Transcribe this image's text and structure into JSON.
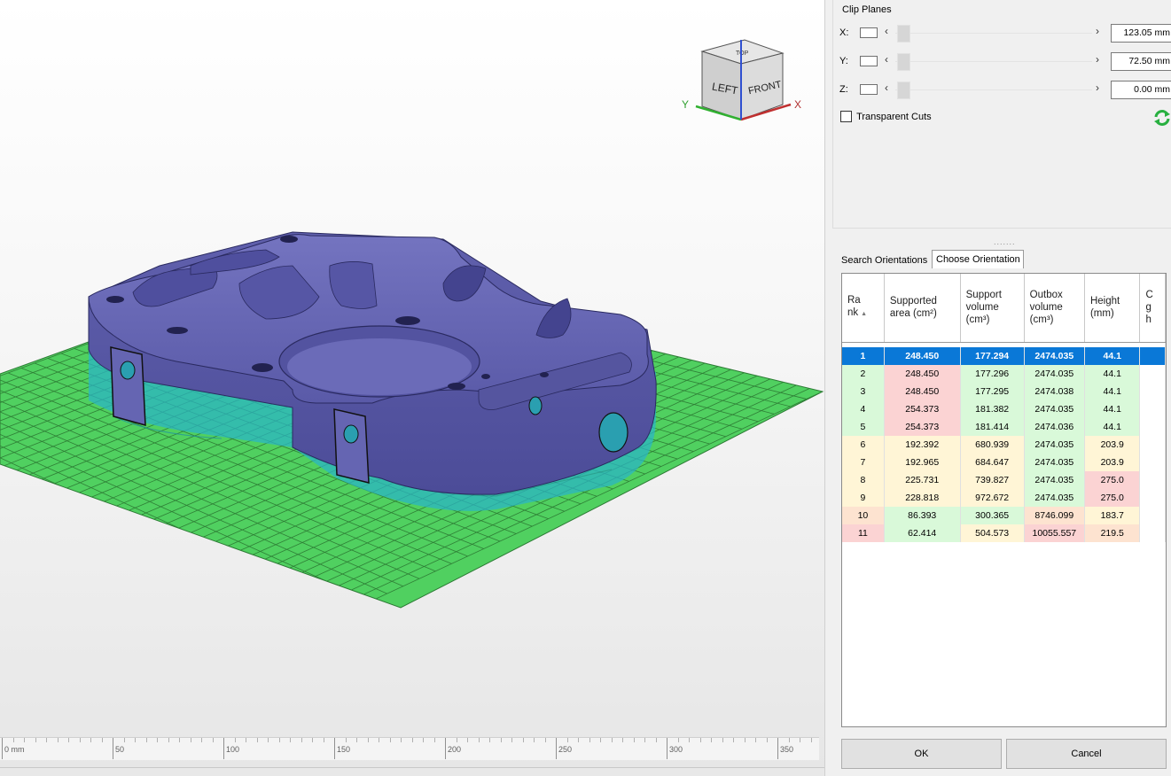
{
  "clip_planes": {
    "title": "Clip Planes",
    "rows": [
      {
        "axis": "X:",
        "value": "123.05 mm"
      },
      {
        "axis": "Y:",
        "value": "72.50 mm"
      },
      {
        "axis": "Z:",
        "value": "0.00 mm"
      }
    ],
    "transparent_cuts_label": "Transparent Cuts",
    "transparent_cuts_checked": false
  },
  "view_cube": {
    "faces": {
      "left": "LEFT",
      "front": "FRONT",
      "top": "TOP"
    },
    "axis_y": "Y",
    "axis_x": "X"
  },
  "ruler": {
    "labels": [
      "0 mm",
      "50",
      "100",
      "150",
      "200",
      "250",
      "300",
      "350"
    ]
  },
  "tabs": [
    {
      "label": "Search Orientations",
      "active": false
    },
    {
      "label": "Choose Orientation",
      "active": true
    }
  ],
  "table": {
    "columns": [
      {
        "line1": "Ra",
        "line2": "nk",
        "line3": ""
      },
      {
        "line1": "Supported",
        "line2": "area (cm²)",
        "line3": ""
      },
      {
        "line1": "Support",
        "line2": "volume",
        "line3": "(cm³)"
      },
      {
        "line1": "Outbox",
        "line2": "volume",
        "line3": "(cm³)"
      },
      {
        "line1": "Height",
        "line2": "(mm)",
        "line3": ""
      },
      {
        "line1": "C",
        "line2": "g",
        "line3": "h"
      }
    ],
    "rows": [
      {
        "rank": "1",
        "area": "248.450",
        "support": "177.294",
        "outbox": "2474.035",
        "height": "44.1",
        "selected": true
      },
      {
        "rank": "2",
        "area": "248.450",
        "support": "177.296",
        "outbox": "2474.035",
        "height": "44.1"
      },
      {
        "rank": "3",
        "area": "248.450",
        "support": "177.295",
        "outbox": "2474.038",
        "height": "44.1"
      },
      {
        "rank": "4",
        "area": "254.373",
        "support": "181.382",
        "outbox": "2474.035",
        "height": "44.1"
      },
      {
        "rank": "5",
        "area": "254.373",
        "support": "181.414",
        "outbox": "2474.036",
        "height": "44.1"
      },
      {
        "rank": "6",
        "area": "192.392",
        "support": "680.939",
        "outbox": "2474.035",
        "height": "203.9"
      },
      {
        "rank": "7",
        "area": "192.965",
        "support": "684.647",
        "outbox": "2474.035",
        "height": "203.9"
      },
      {
        "rank": "8",
        "area": "225.731",
        "support": "739.827",
        "outbox": "2474.035",
        "height": "275.0"
      },
      {
        "rank": "9",
        "area": "228.818",
        "support": "972.672",
        "outbox": "2474.035",
        "height": "275.0"
      },
      {
        "rank": "10",
        "area": "86.393",
        "support": "300.365",
        "outbox": "8746.099",
        "height": "183.7"
      },
      {
        "rank": "11",
        "area": "62.414",
        "support": "504.573",
        "outbox": "10055.557",
        "height": "219.5"
      }
    ],
    "row_colors": [
      [
        "#0a78d7",
        "#0a78d7",
        "#0a78d7",
        "#0a78d7",
        "#0a78d7",
        "#0a78d7"
      ],
      [
        "#d9f9d9",
        "#fbd3d3",
        "#d9f9d9",
        "#d9f9d9",
        "#d9f9d9",
        "#ffffff"
      ],
      [
        "#d9f9d9",
        "#fbd3d3",
        "#d9f9d9",
        "#d9f9d9",
        "#d9f9d9",
        "#ffffff"
      ],
      [
        "#d9f9d9",
        "#fbd3d3",
        "#d9f9d9",
        "#d9f9d9",
        "#d9f9d9",
        "#ffffff"
      ],
      [
        "#d9f9d9",
        "#fbd3d3",
        "#d9f9d9",
        "#d9f9d9",
        "#d9f9d9",
        "#ffffff"
      ],
      [
        "#fff5d6",
        "#fff5d6",
        "#fff5d6",
        "#d9f9d9",
        "#fff5d6",
        "#ffffff"
      ],
      [
        "#fff5d6",
        "#fff5d6",
        "#fff5d6",
        "#d9f9d9",
        "#fff5d6",
        "#ffffff"
      ],
      [
        "#fff5d6",
        "#fff5d6",
        "#fff5d6",
        "#d9f9d9",
        "#fbd3d3",
        "#ffffff"
      ],
      [
        "#fff5d6",
        "#fff5d6",
        "#fff5d6",
        "#d9f9d9",
        "#fbd3d3",
        "#ffffff"
      ],
      [
        "#fde3d0",
        "#d9f9d9",
        "#d9f9d9",
        "#fde3d0",
        "#fff5d6",
        "#ffffff"
      ],
      [
        "#fbd3d3",
        "#d9f9d9",
        "#fff5d6",
        "#fbd3d3",
        "#fde3d0",
        "#ffffff"
      ]
    ]
  },
  "buttons": {
    "ok": "OK",
    "cancel": "Cancel"
  },
  "colors": {
    "model": "#6a6ab5",
    "support": "#2ab5c8",
    "build_plate": "#50d060",
    "selection": "#0a78d7",
    "refresh_icon": "#28b040"
  }
}
